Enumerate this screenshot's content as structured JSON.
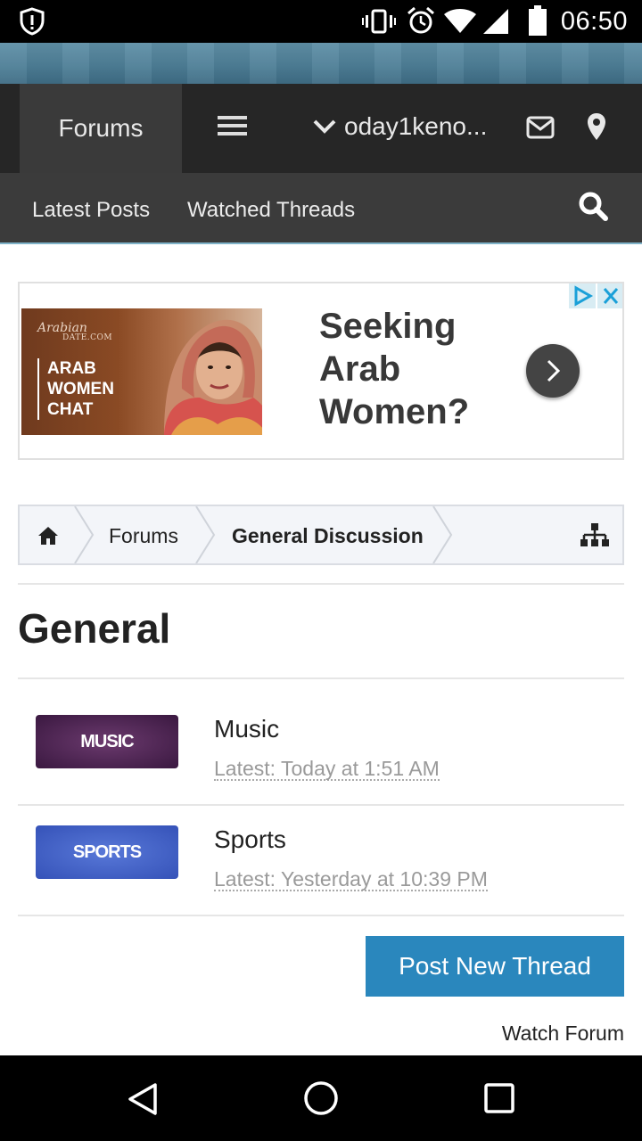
{
  "status_bar": {
    "time": "06:50",
    "icons": [
      "shield-alert-icon",
      "vibrate-icon",
      "alarm-icon",
      "wifi-icon",
      "cellular-icon",
      "battery-icon"
    ]
  },
  "nav": {
    "forums_tab": "Forums",
    "username": "oday1keno...",
    "icons": [
      "hamburger-menu-icon",
      "chevron-down-icon",
      "mail-icon",
      "map-pin-icon"
    ]
  },
  "subnav": {
    "latest_posts": "Latest Posts",
    "watched_threads": "Watched Threads",
    "icons": [
      "search-icon"
    ]
  },
  "ad": {
    "logo": "Arabian",
    "logo_sub": "DATE.COM",
    "tag_lines": [
      "ARAB",
      "WOMEN",
      "CHAT"
    ],
    "headline_lines": [
      "Seeking",
      "Arab",
      "Women?"
    ],
    "icons": [
      "adchoices-icon",
      "close-icon",
      "chevron-right-icon"
    ]
  },
  "breadcrumb": {
    "items": [
      "Forums",
      "General Discussion"
    ],
    "icons": [
      "home-icon",
      "sitemap-icon"
    ]
  },
  "category": {
    "title": "General",
    "forums": [
      {
        "thumb": "MUSIC",
        "name": "Music",
        "latest": "Latest: Today at 1:51 AM",
        "color": "#4a2350"
      },
      {
        "thumb": "SPORTS",
        "name": "Sports",
        "latest": "Latest: Yesterday at 10:39 PM",
        "color": "#3f61c9"
      }
    ]
  },
  "actions": {
    "post_new_thread": "Post New Thread",
    "watch_forum": "Watch Forum"
  },
  "colors": {
    "nav_bg": "#262626",
    "subnav_bg": "#3b3b3b",
    "primary_button": "#2a87bd"
  },
  "system_nav": [
    "back-icon",
    "home-circle-icon",
    "recents-icon"
  ]
}
